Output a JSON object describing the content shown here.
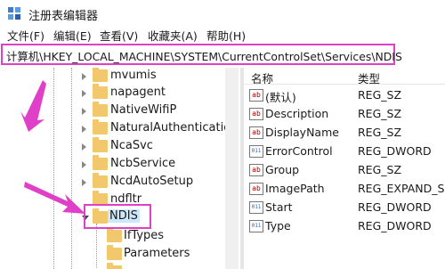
{
  "window": {
    "title": "注册表编辑器"
  },
  "menu": [
    "文件(F)",
    "编辑(E)",
    "查看(V)",
    "收藏夹(A)",
    "帮助(H)"
  ],
  "address": {
    "path": "计算机\\HKEY_LOCAL_MACHINE\\SYSTEM\\CurrentControlSet\\Services\\NDIS"
  },
  "tree": {
    "items": [
      {
        "label": "mvumis",
        "expandable": true
      },
      {
        "label": "napagent",
        "expandable": true
      },
      {
        "label": "NativeWifiP",
        "expandable": true
      },
      {
        "label": "NaturalAuthentication",
        "expandable": true
      },
      {
        "label": "NcaSvc",
        "expandable": true
      },
      {
        "label": "NcbService",
        "expandable": true
      },
      {
        "label": "NcdAutoSetup",
        "expandable": true
      },
      {
        "label": "ndfltr",
        "expandable": false
      },
      {
        "label": "NDIS",
        "expandable": true,
        "selected": true
      },
      {
        "label": "IfTypes",
        "expandable": false
      },
      {
        "label": "Parameters",
        "expandable": false
      }
    ]
  },
  "list": {
    "headers": {
      "name": "名称",
      "type": "类型"
    },
    "values": [
      {
        "name": "(默认)",
        "type": "REG_SZ",
        "icon": "string-value-icon"
      },
      {
        "name": "Description",
        "type": "REG_SZ",
        "icon": "string-value-icon"
      },
      {
        "name": "DisplayName",
        "type": "REG_SZ",
        "icon": "string-value-icon"
      },
      {
        "name": "ErrorControl",
        "type": "REG_DWORD",
        "icon": "binary-value-icon"
      },
      {
        "name": "Group",
        "type": "REG_SZ",
        "icon": "string-value-icon"
      },
      {
        "name": "ImagePath",
        "type": "REG_EXPAND_SZ",
        "icon": "string-value-icon"
      },
      {
        "name": "Start",
        "type": "REG_DWORD",
        "icon": "binary-value-icon"
      },
      {
        "name": "Type",
        "type": "REG_DWORD",
        "icon": "binary-value-icon"
      }
    ]
  },
  "colors": {
    "highlight": "#e040c8",
    "folder": "#f2c86d",
    "selection": "#cce8ff"
  }
}
